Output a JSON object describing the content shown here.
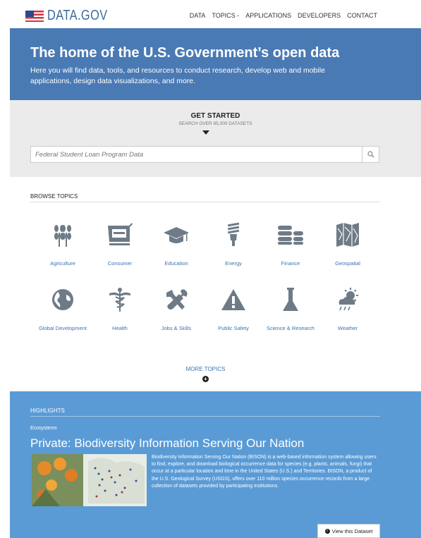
{
  "header": {
    "logo_text": "DATA.GOV",
    "nav": [
      "DATA",
      "TOPICS -",
      "APPLICATIONS",
      "DEVELOPERS",
      "CONTACT"
    ]
  },
  "hero": {
    "title": "The home of the U.S. Government’s open data",
    "subtitle": "Here you will find data, tools, and resources to conduct research, develop web and mobile applications, design data visualizations, and more."
  },
  "get_started": {
    "title": "GET STARTED",
    "subtitle": "SEARCH OVER 85,000 DATASETS",
    "search_placeholder": "Federal Student Loan Program Data"
  },
  "browse": {
    "title": "BROWSE TOPICS",
    "topics": [
      {
        "label": "Agriculture",
        "icon": "wheat-icon"
      },
      {
        "label": "Consumer",
        "icon": "shopping-cart-icon"
      },
      {
        "label": "Education",
        "icon": "graduation-cap-icon"
      },
      {
        "label": "Energy",
        "icon": "lightbulb-icon"
      },
      {
        "label": "Finance",
        "icon": "coins-icon"
      },
      {
        "label": "Geospatial",
        "icon": "map-icon"
      },
      {
        "label": "Global Development",
        "icon": "globe-icon"
      },
      {
        "label": "Health",
        "icon": "caduceus-icon"
      },
      {
        "label": "Jobs & Skills",
        "icon": "tools-icon"
      },
      {
        "label": "Public Safety",
        "icon": "warning-icon"
      },
      {
        "label": "Science & Research",
        "icon": "flask-icon"
      },
      {
        "label": "Weather",
        "icon": "weather-icon"
      }
    ],
    "more_label": "MORE TOPICS"
  },
  "highlights": {
    "title": "HIGHLIGHTS",
    "category": "Ecosystems",
    "headline": "Private: Biodiversity Information Serving Our Nation",
    "description": "Biodiversity Information Serving Our Nation (BISON) is a web-based information system allowing users to find, explore, and download biological occurrence data for species (e.g. plants, animals, fungi) that occur at a particular location and time in the United States (U.S.) and Territories. BISON, a product of the U.S. Geological Survey (USGS), offers over 110 million species occurrence records from a large collection of datasets provided by participating institutions.",
    "button_label": "View this Dataset"
  },
  "colors": {
    "hero_bg": "#4a7ab4",
    "highlights_bg": "#5a9bd6",
    "link": "#3d73b0",
    "icon": "#6e7b87"
  }
}
